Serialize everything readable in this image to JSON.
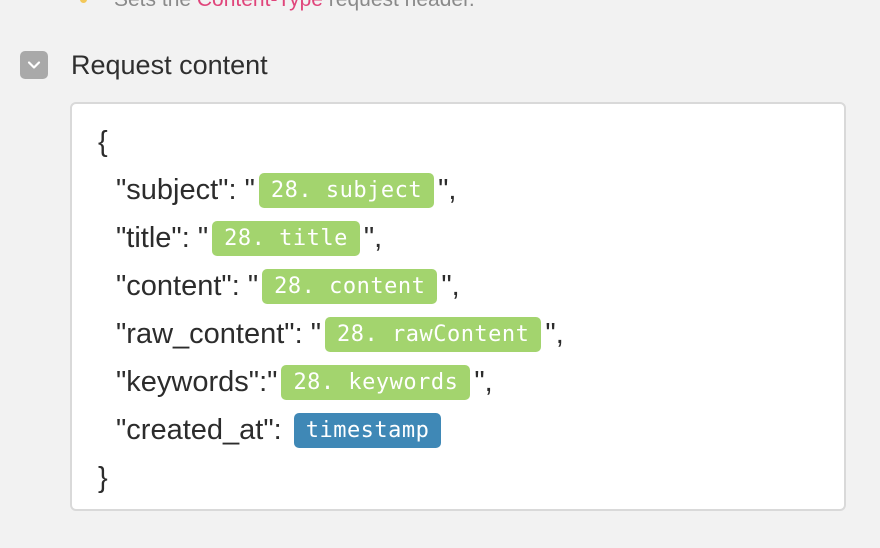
{
  "hint": {
    "prefix": "Sets the ",
    "code": "Content-Type",
    "suffix": " request header."
  },
  "section": {
    "title": "Request content"
  },
  "request_body": {
    "open_brace": "{",
    "close_brace": "}",
    "fields": [
      {
        "key_text": "\"subject\": \"",
        "pill": "28. subject",
        "after": "\",",
        "pill_kind": "green"
      },
      {
        "key_text": "\"title\": \"",
        "pill": "28. title",
        "after": "\",",
        "pill_kind": "green"
      },
      {
        "key_text": "\"content\": \"",
        "pill": "28. content",
        "after": "\",",
        "pill_kind": "green"
      },
      {
        "key_text": "\"raw_content\": \"",
        "pill": "28. rawContent",
        "after": "\",",
        "pill_kind": "green"
      },
      {
        "key_text": "\"keywords\":\"",
        "pill": "28. keywords",
        "after": "\",",
        "pill_kind": "green"
      },
      {
        "key_text": "\"created_at\":",
        "pill": "timestamp",
        "after": "",
        "pill_kind": "blue"
      }
    ]
  },
  "colors": {
    "background": "#f2f2f2",
    "pill_green": "#a3d46e",
    "pill_blue": "#3f88b6",
    "hint_code": "#e0457b",
    "toggle_box": "#a9a9a9"
  },
  "icons": {
    "toggle": "chevron-down-icon",
    "hint_bullet": "dot-icon"
  }
}
